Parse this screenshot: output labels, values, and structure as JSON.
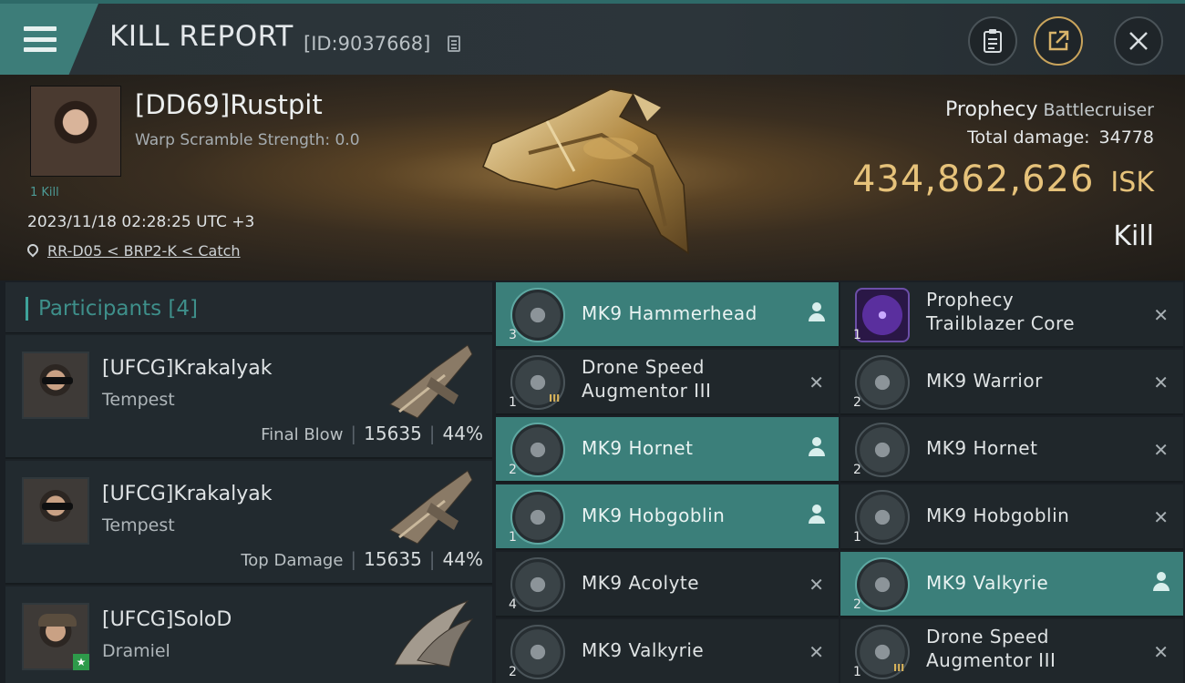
{
  "header": {
    "title": "KILL REPORT",
    "report_id": "[ID:9037668]"
  },
  "victim": {
    "name": "[DD69]Rustpit",
    "warp_scramble": "Warp Scramble Strength: 0.0",
    "kills": "1 Kill",
    "datetime": "2023/11/18 02:28:25 UTC +3",
    "location": "RR-D05 < BRP2-K < Catch",
    "ship_name": "Prophecy",
    "ship_class": "Battlecruiser",
    "total_damage_label": "Total damage:",
    "total_damage": "34778",
    "isk_value": "434,862,626",
    "isk_unit": "ISK",
    "result": "Kill"
  },
  "participants": {
    "title": "Participants [4]",
    "rows": [
      {
        "name": "[UFCG]Krakalyak",
        "ship": "Tempest",
        "label": "Final Blow",
        "damage": "15635",
        "percent": "44%"
      },
      {
        "name": "[UFCG]Krakalyak",
        "ship": "Tempest",
        "label": "Top Damage",
        "damage": "15635",
        "percent": "44%"
      },
      {
        "name": "[UFCG]SoloD",
        "ship": "Dramiel"
      }
    ]
  },
  "items": {
    "left": [
      {
        "name": "MK9  Hammerhead",
        "qty": "3",
        "highlighted": true
      },
      {
        "name": "Drone Speed Augmentor III",
        "qty": "1",
        "tier": "III",
        "highlighted": false
      },
      {
        "name": "MK9  Hornet",
        "qty": "2",
        "highlighted": true
      },
      {
        "name": "MK9  Hobgoblin",
        "qty": "1",
        "highlighted": true
      },
      {
        "name": "MK9  Acolyte",
        "qty": "4",
        "highlighted": false
      },
      {
        "name": "MK9  Valkyrie",
        "qty": "2",
        "highlighted": false
      }
    ],
    "right": [
      {
        "name": "Prophecy Trailblazer Core",
        "qty": "1",
        "highlighted": false
      },
      {
        "name": "MK9  Warrior",
        "qty": "2",
        "highlighted": false
      },
      {
        "name": "MK9  Hornet",
        "qty": "2",
        "highlighted": false
      },
      {
        "name": "MK9  Hobgoblin",
        "qty": "1",
        "highlighted": false
      },
      {
        "name": "MK9  Valkyrie",
        "qty": "2",
        "highlighted": true
      },
      {
        "name": "Drone Speed Augmentor III",
        "qty": "1",
        "tier": "III",
        "highlighted": false
      }
    ],
    "remove_glyph": "✕"
  },
  "icons": {
    "menu": "hamburger-icon",
    "copy": "copy-icon",
    "clipboard": "clipboard-icon",
    "share": "share-icon",
    "close": "close-icon",
    "location": "location-pin-icon",
    "person": "person-icon"
  },
  "colors": {
    "accent": "#3d7d79",
    "isk": "#e6c27a",
    "highlight_row": "#3b7f7a"
  }
}
